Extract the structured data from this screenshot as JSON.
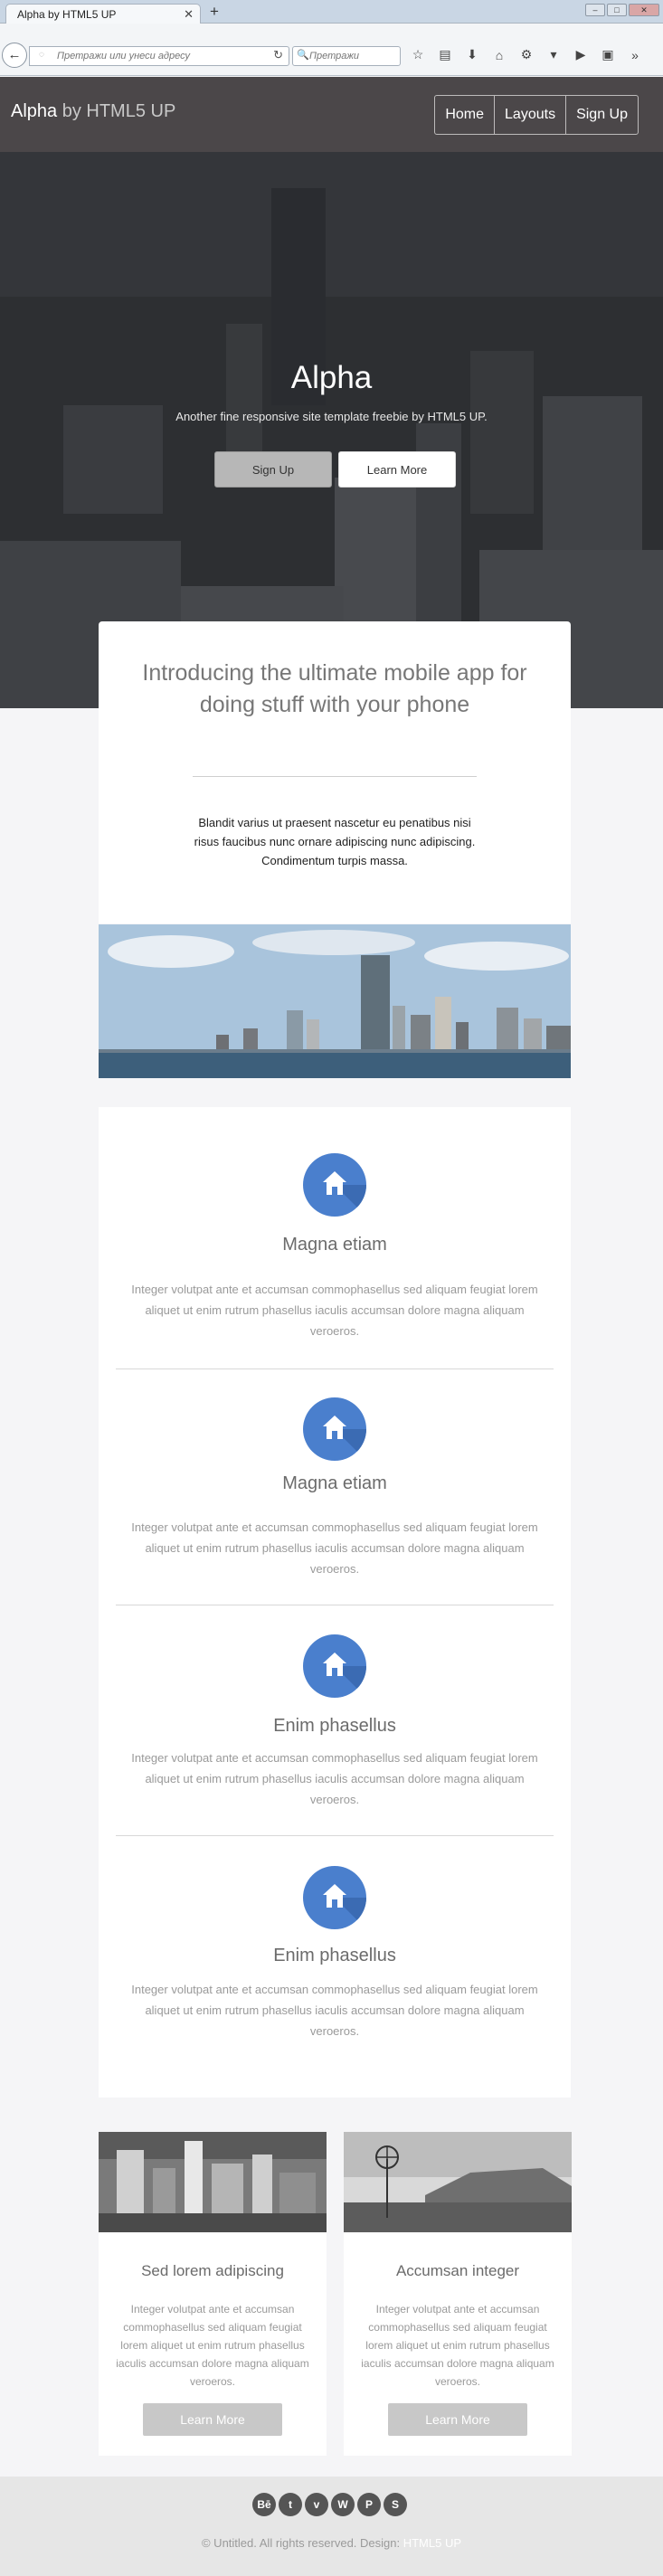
{
  "browser": {
    "tab_title": "Alpha by HTML5 UP",
    "tab_close": "✕",
    "new_tab": "+",
    "url_placeholder": "Претражи или унеси адресу",
    "search_placeholder": "Претражи",
    "window_min": "–",
    "window_max": "□",
    "window_close": "✕"
  },
  "header": {
    "logo_main": "Alpha",
    "logo_by": " by HTML5 UP",
    "nav": [
      "Home",
      "Layouts",
      "Sign Up"
    ]
  },
  "banner": {
    "title": "Alpha",
    "subtitle": "Another fine responsive site template freebie by HTML5 UP.",
    "signup_label": "Sign Up",
    "learn_label": "Learn More"
  },
  "intro": {
    "title": "Introducing the ultimate mobile app for doing stuff with your phone",
    "text": "Blandit varius ut praesent nascetur eu penatibus nisi risus faucibus nunc ornare adipiscing nunc adipiscing. Condimentum turpis massa."
  },
  "features": [
    {
      "title": "Magna etiam",
      "text": "Integer volutpat ante et accumsan commophasellus sed aliquam feugiat lorem aliquet ut enim rutrum phasellus iaculis accumsan dolore magna aliquam veroeros."
    },
    {
      "title": "Magna etiam",
      "text": "Integer volutpat ante et accumsan commophasellus sed aliquam feugiat lorem aliquet ut enim rutrum phasellus iaculis accumsan dolore magna aliquam veroeros."
    },
    {
      "title": "Enim phasellus",
      "text": "Integer volutpat ante et accumsan commophasellus sed aliquam feugiat lorem aliquet ut enim rutrum phasellus iaculis accumsan dolore magna aliquam veroeros."
    },
    {
      "title": "Enim phasellus",
      "text": "Integer volutpat ante et accumsan commophasellus sed aliquam feugiat lorem aliquet ut enim rutrum phasellus iaculis accumsan dolore magna aliquam veroeros."
    }
  ],
  "cards": [
    {
      "title": "Sed lorem adipiscing",
      "text": "Integer volutpat ante et accumsan commophasellus sed aliquam feugiat lorem aliquet ut enim rutrum phasellus iaculis accumsan dolore magna aliquam veroeros.",
      "button": "Learn More"
    },
    {
      "title": "Accumsan integer",
      "text": "Integer volutpat ante et accumsan commophasellus sed aliquam feugiat lorem aliquet ut enim rutrum phasellus iaculis accumsan dolore magna aliquam veroeros.",
      "button": "Learn More"
    }
  ],
  "footer": {
    "socials": [
      "Bē",
      "t",
      "v",
      "W",
      "P",
      "S"
    ],
    "copyright": "© Untitled. All rights reserved. Design: ",
    "design_link": "HTML5 UP"
  },
  "colors": {
    "accent": "#4a7fcd",
    "header_bg": "#4b4749",
    "footer_bg": "#e6e6e6"
  }
}
